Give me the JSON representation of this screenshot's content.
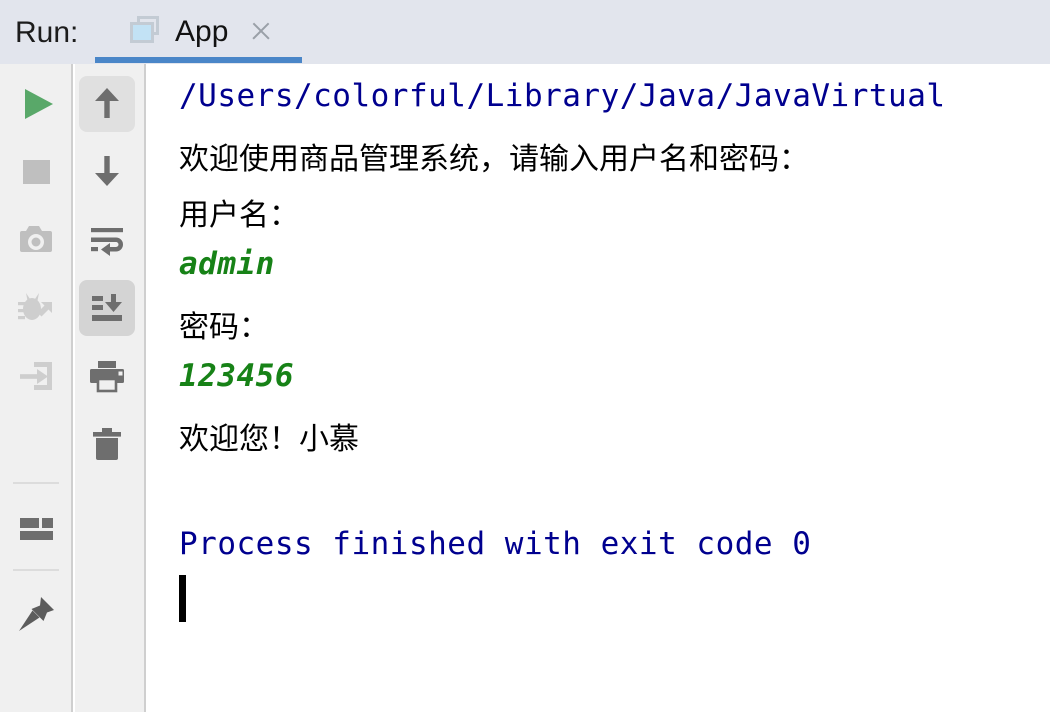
{
  "header": {
    "run_label": "Run:",
    "tab": {
      "title": "App",
      "icon": "run-configuration-icon",
      "close_icon": "close-icon",
      "active": true,
      "underline_color": "#4a86c8"
    },
    "background_color": "#e2e5ed"
  },
  "run_toolbar": {
    "name": "run-tool-window-toolbar",
    "buttons": [
      {
        "name": "rerun-button",
        "icon": "play-icon",
        "label": "Rerun 'App'",
        "state": "enabled",
        "color": "#59a869"
      },
      {
        "name": "stop-button",
        "icon": "stop-icon",
        "label": "Stop",
        "state": "disabled",
        "color": "#bfbfbf"
      },
      {
        "name": "screenshot-button",
        "icon": "camera-icon",
        "label": "Take Screenshot",
        "state": "disabled",
        "color": "#bfbfbf"
      },
      {
        "name": "rerun-failed-button",
        "icon": "bug-rerun-icon",
        "label": "Rerun Failed Tests",
        "state": "disabled",
        "color": "#cecece"
      },
      {
        "name": "attach-profiler-button",
        "icon": "attach-arrow-icon",
        "label": "Attach Profiler",
        "state": "disabled",
        "color": "#cecece"
      },
      {
        "name": "layout-settings-button",
        "icon": "layout-icon",
        "label": "Layout Settings",
        "state": "enabled",
        "color": "#6e6e6e"
      },
      {
        "name": "pin-tab-button",
        "icon": "pin-icon",
        "label": "Pin Tab",
        "state": "enabled",
        "color": "#5c5c5c"
      }
    ]
  },
  "console_toolbar": {
    "name": "console-actions-toolbar",
    "buttons": [
      {
        "name": "up-occurrence-button",
        "icon": "arrow-up-icon",
        "label": "Up the Stack Trace",
        "selected": true,
        "highlight": "light",
        "color": "#6e6e6e"
      },
      {
        "name": "down-occurrence-button",
        "icon": "arrow-down-icon",
        "label": "Down the Stack Trace",
        "selected": false,
        "highlight": "none",
        "color": "#6e6e6e"
      },
      {
        "name": "soft-wrap-button",
        "icon": "soft-wrap-icon",
        "label": "Use Soft Wraps",
        "selected": false,
        "highlight": "none",
        "color": "#6e6e6e"
      },
      {
        "name": "scroll-to-end-button",
        "icon": "scroll-to-end-icon",
        "label": "Scroll to the End",
        "selected": true,
        "highlight": "dark",
        "color": "#6e6e6e"
      },
      {
        "name": "print-button",
        "icon": "printer-icon",
        "label": "Print",
        "selected": false,
        "highlight": "none",
        "color": "#6e6e6e"
      },
      {
        "name": "clear-all-button",
        "icon": "trash-icon",
        "label": "Clear All",
        "selected": false,
        "highlight": "none",
        "color": "#6e6e6e"
      }
    ]
  },
  "console": {
    "name": "run-console-output",
    "background_color": "#ffffff",
    "lines": [
      {
        "text": "/Users/colorful/Library/Java/JavaVirtual",
        "style": "mono",
        "color": "#00008f",
        "truncated": true
      },
      {
        "text": "欢迎使用商品管理系统，请输入用户名和密码：",
        "style": "cjk",
        "color": "#000000"
      },
      {
        "text": "用户名：",
        "style": "cjk",
        "color": "#000000"
      },
      {
        "text": "admin",
        "style": "mono-italic",
        "color": "#178217"
      },
      {
        "text": "密码：",
        "style": "cjk",
        "color": "#000000"
      },
      {
        "text": "123456",
        "style": "mono-italic",
        "color": "#178217"
      },
      {
        "text": "欢迎您！小慕",
        "style": "cjk",
        "color": "#000000"
      },
      {
        "text": "",
        "style": "cjk",
        "color": "#000000"
      },
      {
        "text": "Process finished with exit code 0",
        "style": "mono",
        "color": "#00008f"
      }
    ],
    "caret": {
      "name": "text-caret",
      "visible": true,
      "color": "#000000"
    }
  }
}
